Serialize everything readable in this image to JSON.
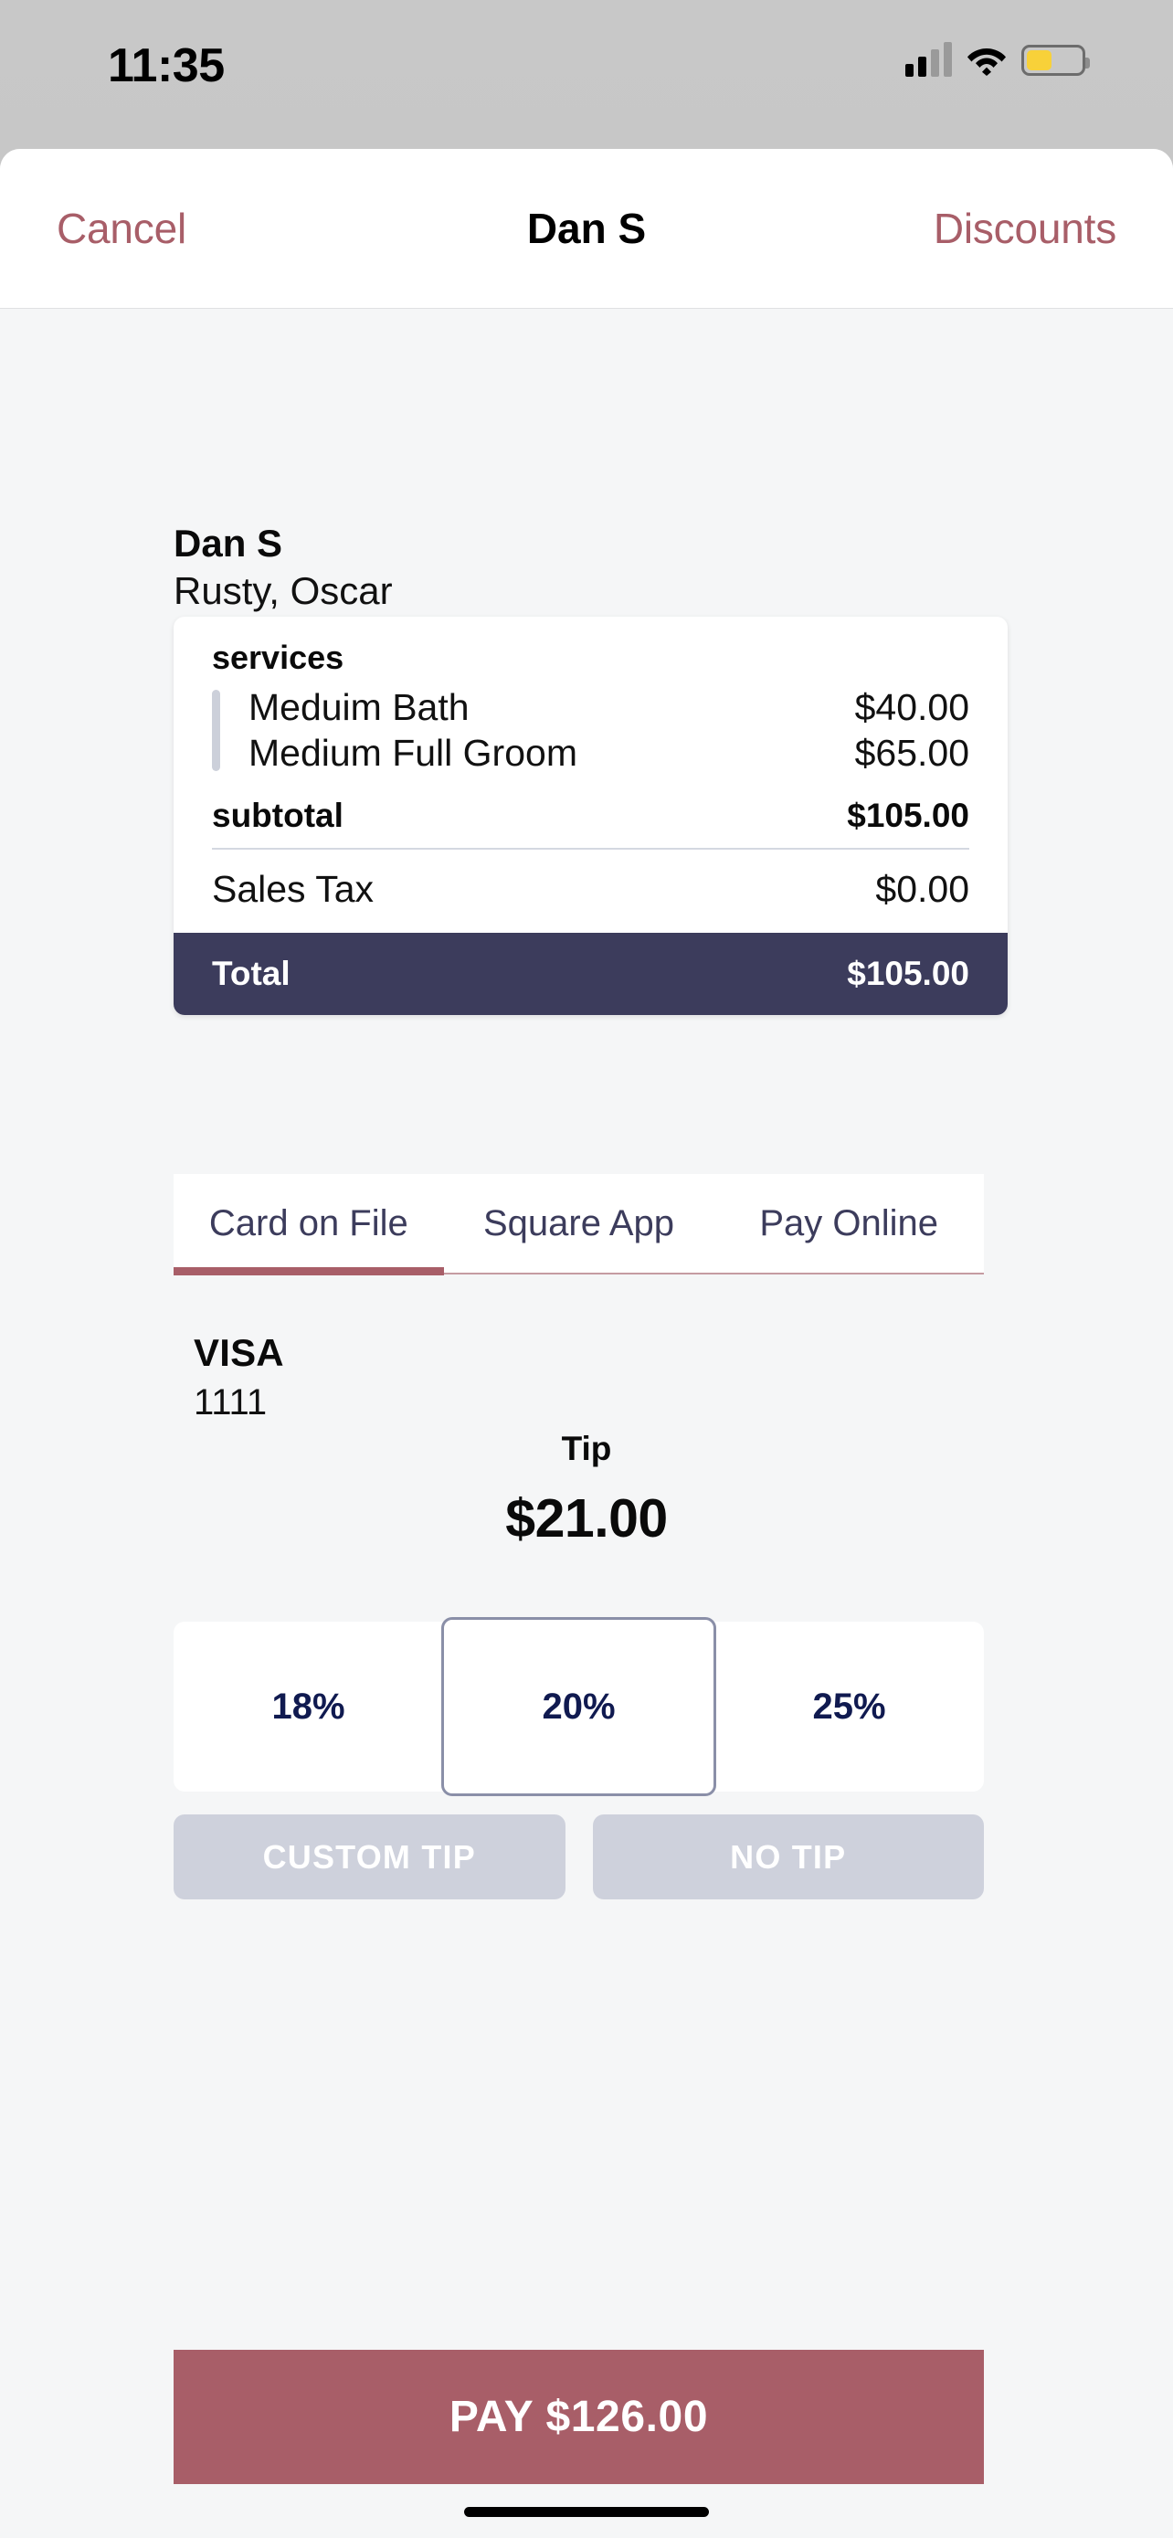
{
  "status_bar": {
    "time": "11:35",
    "cellular_icon": "cellular-signal-icon",
    "wifi_icon": "wifi-icon",
    "battery_icon": "battery-low-power-icon"
  },
  "nav": {
    "cancel_label": "Cancel",
    "title": "Dan S",
    "discounts_label": "Discounts",
    "accent_color": "#a85e68"
  },
  "customer": {
    "name": "Dan S",
    "pets": "Rusty, Oscar"
  },
  "receipt": {
    "section_header": "services",
    "items": [
      {
        "name": "Meduim Bath",
        "price": "$40.00"
      },
      {
        "name": "Medium Full Groom",
        "price": "$65.00"
      }
    ],
    "subtotal_label": "subtotal",
    "subtotal_value": "$105.00",
    "tax_label": "Sales Tax",
    "tax_value": "$0.00",
    "total_label": "Total",
    "total_value": "$105.00",
    "total_bar_color": "#3c3c5c"
  },
  "payment_tabs": {
    "items": [
      {
        "label": "Card on File",
        "active": true
      },
      {
        "label": "Square App",
        "active": false
      },
      {
        "label": "Pay Online",
        "active": false
      }
    ],
    "indicator_color": "#a85e68",
    "label_color": "#3c3c5c"
  },
  "card_on_file": {
    "brand": "VISA",
    "last4": "1111"
  },
  "tip": {
    "label": "Tip",
    "amount": "$21.00",
    "options": [
      {
        "percent": "18%",
        "selected": false
      },
      {
        "percent": "20%",
        "selected": true
      },
      {
        "percent": "25%",
        "selected": false
      }
    ],
    "option_text_color": "#101a50",
    "custom_tip_label": "CUSTOM TIP",
    "no_tip_label": "NO TIP",
    "action_button_color": "#ced1dc"
  },
  "pay": {
    "label": "PAY $126.00",
    "color": "#a85e68"
  }
}
